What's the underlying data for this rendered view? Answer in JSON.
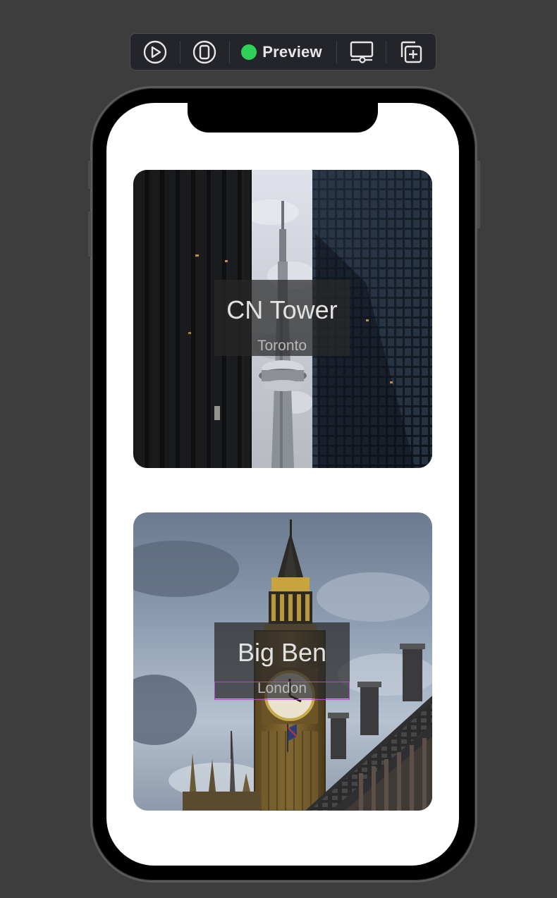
{
  "toolbar": {
    "play_icon": "play-circle-icon",
    "device_icon": "device-icon",
    "preview_label": "Preview",
    "preview_status_color": "#30d158",
    "display_icon": "display-settings-icon",
    "duplicate_icon": "duplicate-plus-icon"
  },
  "cards": [
    {
      "title": "CN Tower",
      "subtitle": "Toronto"
    },
    {
      "title": "Big Ben",
      "subtitle": "London"
    }
  ]
}
